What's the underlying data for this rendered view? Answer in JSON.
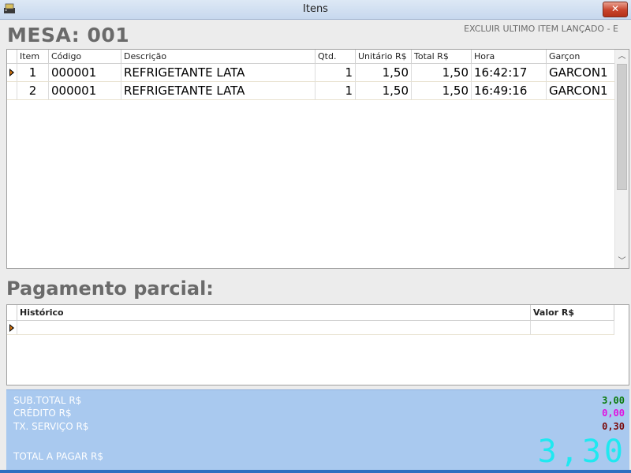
{
  "window": {
    "title": "Itens",
    "close_label": "✕"
  },
  "header": {
    "mesa": "MESA: 001",
    "hint": "EXCLUIR ULTIMO ITEM LANÇADO - E"
  },
  "items_grid": {
    "columns": [
      "Item",
      "Código",
      "Descrição",
      "Qtd.",
      "Unitário R$",
      "Total R$",
      "Hora",
      "Garçon"
    ],
    "rows": [
      {
        "item": "1",
        "codigo": "000001",
        "descricao": "REFRIGETANTE LATA",
        "qtd": "1",
        "unitario": "1,50",
        "total": "1,50",
        "hora": "16:42:17",
        "garcon": "GARCON1"
      },
      {
        "item": "2",
        "codigo": "000001",
        "descricao": "REFRIGETANTE LATA",
        "qtd": "1",
        "unitario": "1,50",
        "total": "1,50",
        "hora": "16:49:16",
        "garcon": "GARCON1"
      }
    ]
  },
  "pagamento": {
    "title": "Pagamento parcial:",
    "columns": [
      "Histórico",
      "Valor R$"
    ]
  },
  "totals": {
    "subtotal_label": "SUB.TOTAL R$",
    "subtotal_value": "3,00",
    "credito_label": "CRÉDITO R$",
    "credito_value": "0,00",
    "servico_label": "TX. SERVIÇO R$",
    "servico_value": "0,30",
    "total_label": "TOTAL A PAGAR R$",
    "total_value": "3,30",
    "colors": {
      "subtotal": "#0a7a0a",
      "credito": "#e010e0",
      "servico": "#7a0a0a",
      "total": "#1fe8f0"
    }
  }
}
